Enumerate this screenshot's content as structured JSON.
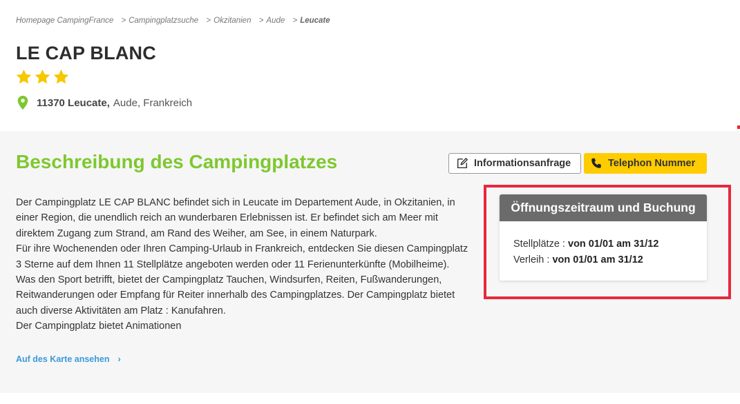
{
  "breadcrumb": {
    "items": [
      "Homepage CampingFrance",
      "Campingplatzsuche",
      "Okzitanien",
      "Aude"
    ],
    "current": "Leucate",
    "separator": ">"
  },
  "campsite": {
    "name": "LE CAP BLANC",
    "stars": 3,
    "location_bold": "11370 Leucate,",
    "location_rest": "Aude, Frankreich"
  },
  "description": {
    "title": "Beschreibung des Campingplatzes",
    "paragraphs": [
      "Der Campingplatz LE CAP BLANC befindet sich in Leucate im Departement Aude, in Okzitanien, in einer Region, die unendlich reich an wunderbaren Erlebnissen ist. Er befindet sich am Meer mit direktem Zugang zum Strand, am Rand des Weiher, am See, in einem Naturpark.",
      "Für ihre Wochenenden oder Ihren Camping-Urlaub in Frankreich, entdecken Sie diesen Campingplatz 3 Sterne auf dem Ihnen 11 Stellplätze angeboten werden oder 11 Ferienunterkünfte (Mobilheime).",
      "Was den Sport betrifft, bietet der Campingplatz Tauchen, Windsurfen, Reiten, Fußwanderungen, Reitwanderungen oder Empfang für Reiter innerhalb des Campingplatzes. Der Campingplatz bietet auch diverse Aktivitäten am Platz : Kanufahren.",
      "Der Campingplatz bietet Animationen"
    ],
    "map_link": "Auf des Karte ansehen",
    "map_link_icon": "chevron-right-icon"
  },
  "actions": {
    "info_label": "Informationsanfrage",
    "info_icon": "edit-icon",
    "phone_label": "Telephon Nummer",
    "phone_icon": "phone-icon"
  },
  "booking": {
    "title": "Öffnungszeitraum und Buchung",
    "rows": [
      {
        "label": "Stellplätze :",
        "value": "von 01/01 am 31/12"
      },
      {
        "label": "Verleih :",
        "value": "von 01/01 am 31/12"
      }
    ]
  },
  "colors": {
    "accent_green": "#7ec82f",
    "star_yellow": "#f5c800",
    "phone_button": "#ffcc00",
    "link_blue": "#3a9ad9",
    "highlight_red": "#e8283c",
    "booking_header": "#6b6b6b"
  }
}
